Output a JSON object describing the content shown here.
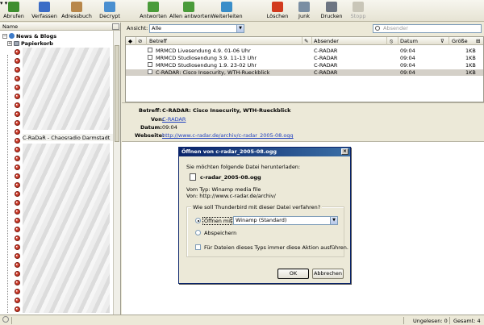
{
  "toolbar": {
    "buttons": [
      {
        "label": "Abrufen",
        "icon": "get-mail-icon",
        "color": "#3e8e2e"
      },
      {
        "label": "Verfassen",
        "icon": "compose-icon",
        "color": "#3b6cc6"
      },
      {
        "label": "Adressbuch",
        "icon": "address-book-icon",
        "color": "#b8874a"
      },
      {
        "label": "Decrypt",
        "icon": "decrypt-icon",
        "color": "#4a8fd0"
      },
      {
        "label": "Antworten",
        "icon": "reply-icon",
        "color": "#4a9b3a"
      },
      {
        "label": "Allen antworten",
        "icon": "reply-all-icon",
        "color": "#4a9b3a"
      },
      {
        "label": "Weiterleiten",
        "icon": "forward-icon",
        "color": "#3a8ec9"
      },
      {
        "label": "Löschen",
        "icon": "delete-icon",
        "color": "#d23a1e"
      },
      {
        "label": "Junk",
        "icon": "junk-icon",
        "color": "#7a8ea3"
      },
      {
        "label": "Drucken",
        "icon": "print-icon",
        "color": "#6d7582"
      },
      {
        "label": "Stopp",
        "icon": "stop-icon",
        "color": "#c9c6b8"
      }
    ]
  },
  "folder_pane": {
    "header": "Name",
    "account": "News & Blogs",
    "trash": "Papierkorb",
    "feed_visible": "C-RaDaR - Chaosradio Darmstadt"
  },
  "viewbar": {
    "view_label": "Ansicht:",
    "view_value": "Alle",
    "search_placeholder": "Absender"
  },
  "message_list": {
    "columns": {
      "subject": "Betreff",
      "sender": "Absender",
      "date": "Datum",
      "size": "Größe"
    },
    "rows": [
      {
        "subject": "MRMCD Livesendung 4.9. 01-06 Uhr",
        "sender": "C-RADAR",
        "date": "09:04",
        "size": "1KB",
        "selected": false
      },
      {
        "subject": "MRMCD Studiosendung 3.9. 11-13 Uhr",
        "sender": "C-RADAR",
        "date": "09:04",
        "size": "1KB",
        "selected": false
      },
      {
        "subject": "MRMCD Studiosendung 1.9. 23-02 Uhr",
        "sender": "C-RADAR",
        "date": "09:04",
        "size": "1KB",
        "selected": false
      },
      {
        "subject": "C-RADAR: Cisco Insecurity, WTH-Rueckblick",
        "sender": "C-RADAR",
        "date": "09:04",
        "size": "1KB",
        "selected": true
      }
    ]
  },
  "message_header": {
    "subject_label": "Betreff:",
    "subject": "C-RADAR: Cisco Insecurity, WTH-Rueckblick",
    "from_label": "Von:",
    "from": "C-RADAR",
    "date_label": "Datum:",
    "date": "09:04",
    "website_label": "Webseite:",
    "website": "http://www.c-radar.de/archiv/c-radar_2005-08.ogg"
  },
  "dialog": {
    "title": "Öffnen von c-radar_2005-08.ogg",
    "intro": "Sie möchten folgende Datei herunterladen:",
    "filename": "c-radar_2005-08.ogg",
    "type_line": "Vom Typ:  Winamp media file",
    "from_line": "Von:  http://www.c-radar.de/archiv/",
    "question": "Wie soll Thunderbird mit dieser Datei verfahren?",
    "open_with_label": "Öffnen mit",
    "open_with_app": "Winamp (Standard)",
    "save_label": "Abspeichern",
    "always_label": "Für Dateien dieses Typs immer diese Aktion ausführen.",
    "ok": "OK",
    "cancel": "Abbrechen",
    "close": "×"
  },
  "status": {
    "unread": "Ungelesen: 0",
    "total": "Gesamt: 4"
  }
}
